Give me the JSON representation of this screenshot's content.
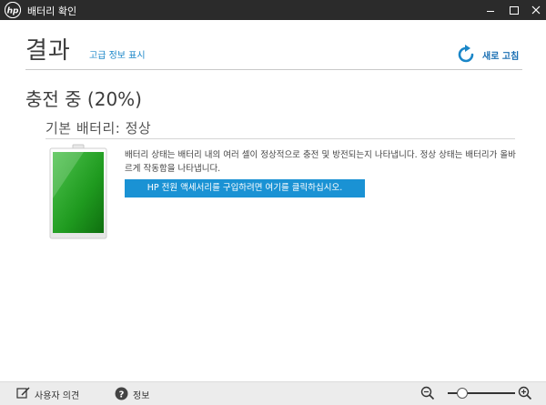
{
  "window": {
    "title": "배터리 확인",
    "logo_text": "hp"
  },
  "header": {
    "title": "결과",
    "advanced_link": "고급 정보 표시",
    "refresh_label": "새로 고침"
  },
  "status": {
    "charge_text": "충전 중 (20%)",
    "charge_percent": 20,
    "primary_battery": "기본 배터리: 정상",
    "description": "배터리 상태는 배터리 내의 여러 셀이 정상적으로 충전 및 방전되는지 나타냅니다. 정상 상태는 배터리가 올바르게 작동함을 나타냅니다.",
    "buy_button": "HP 전원 액세서리를 구입하려면 여기를 클릭하십시오."
  },
  "footer": {
    "feedback": "사용자 의견",
    "info": "정보"
  },
  "zoom": {
    "level": 0.22
  },
  "colors": {
    "accent": "#1a92d4",
    "battery_green": "#2aa52a",
    "titlebar": "#2b2b2b"
  }
}
